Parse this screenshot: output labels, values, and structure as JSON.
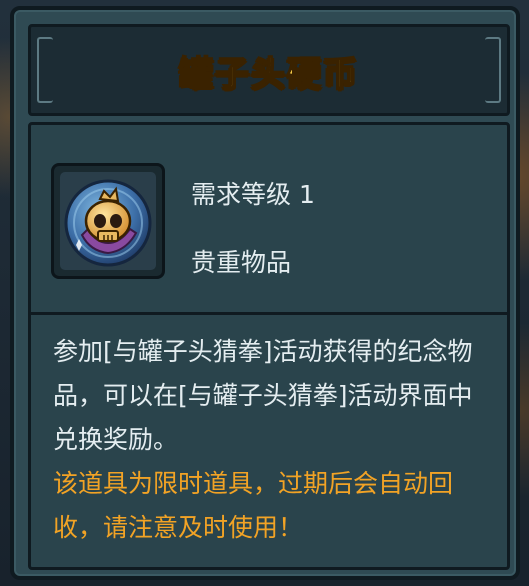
{
  "dialog": {
    "title": "罐子头硬币",
    "level_text": "需求等级 1",
    "rarity_text": "贵重物品",
    "description": "参加[与罐子头猜拳]活动获得的纪念物品，可以在[与罐子头猜拳]活动界面中兑换奖励。",
    "warning": "该道具为限时道具，过期后会自动回收，请注意及时使用！",
    "item_icon": "skull-coin-icon"
  },
  "colors": {
    "title": "#ffd34a",
    "warning": "#f2a325",
    "panel": "#2f4a53",
    "text": "#e4edf0"
  }
}
